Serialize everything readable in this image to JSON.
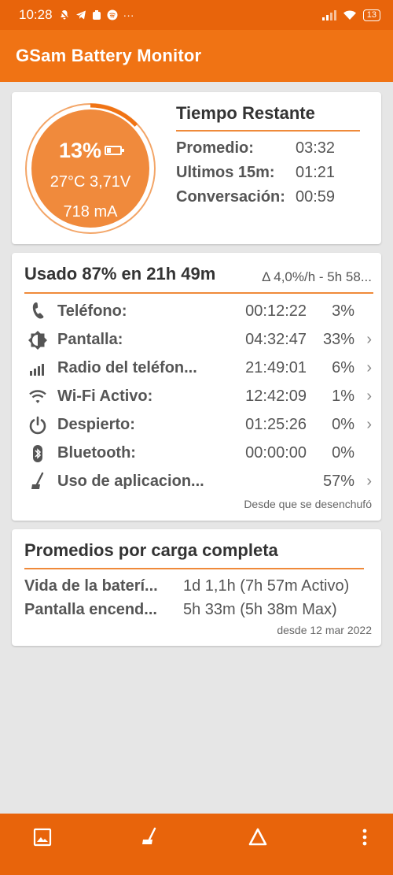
{
  "status_bar": {
    "time": "10:28",
    "more": "···",
    "battery": "13"
  },
  "app": {
    "title": "GSam Battery Monitor"
  },
  "gauge": {
    "percent": "13%",
    "percent_value": 13,
    "temp_voltage": "27°C 3,71V",
    "current": "718 mA"
  },
  "tiempo_restante": {
    "title": "Tiempo Restante",
    "rows": [
      {
        "label": "Promedio:",
        "value": "03:32"
      },
      {
        "label": "Ultimos 15m:",
        "value": "01:21"
      },
      {
        "label": "Conversación:",
        "value": "00:59"
      }
    ]
  },
  "usage": {
    "title": "Usado 87% en 21h 49m",
    "delta": "Δ 4,0%/h - 5h 58...",
    "rows": [
      {
        "icon": "phone-icon",
        "label": "Teléfono:",
        "time": "00:12:22",
        "percent": "3%",
        "chevron": ""
      },
      {
        "icon": "brightness-icon",
        "label": "Pantalla:",
        "time": "04:32:47",
        "percent": "33%",
        "chevron": "›"
      },
      {
        "icon": "signal-icon",
        "label": "Radio del teléfon...",
        "time": "21:49:01",
        "percent": "6%",
        "chevron": "›"
      },
      {
        "icon": "wifi-icon",
        "label": "Wi-Fi Activo:",
        "time": "12:42:09",
        "percent": "1%",
        "chevron": "›"
      },
      {
        "icon": "power-icon",
        "label": "Despierto:",
        "time": "01:25:26",
        "percent": "0%",
        "chevron": "›"
      },
      {
        "icon": "bluetooth-icon",
        "label": "Bluetooth:",
        "time": "00:00:00",
        "percent": "0%",
        "chevron": ""
      },
      {
        "icon": "broom-icon",
        "label": "Uso de aplicacion...",
        "time": "",
        "percent": "57%",
        "chevron": "›"
      }
    ],
    "footer": "Desde que se desenchufó"
  },
  "promedios": {
    "title": "Promedios por carga completa",
    "rows": [
      {
        "label": "Vida de la baterí...",
        "value": "1d 1,1h (7h 57m Activo)"
      },
      {
        "label": "Pantalla encend...",
        "value": "5h 33m (5h 38m Max)"
      }
    ],
    "footer": "desde 12 mar 2022"
  },
  "colors": {
    "primary": "#f07314",
    "dark_primary": "#e8640b",
    "gauge_fill": "#f08a3c",
    "accent_line": "#ef8a3a"
  }
}
